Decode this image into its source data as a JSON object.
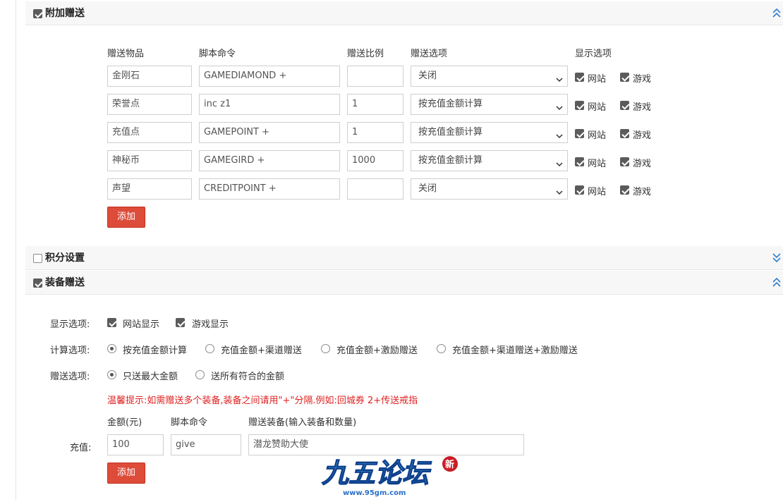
{
  "section1": {
    "title": "附加赠送",
    "columns": [
      "赠送物品",
      "脚本命令",
      "赠送比例",
      "赠送选项",
      "显示选项"
    ],
    "rows": [
      {
        "item": "金刚石",
        "command": "GAMEDIAMOND +",
        "ratio": "",
        "option": "关闭",
        "web": "网站",
        "game": "游戏"
      },
      {
        "item": "荣誉点",
        "command": "inc  z1",
        "ratio": "1",
        "option": "按充值金额计算",
        "web": "网站",
        "game": "游戏"
      },
      {
        "item": "充值点",
        "command": "GAMEPOINT +",
        "ratio": "1",
        "option": "按充值金额计算",
        "web": "网站",
        "game": "游戏"
      },
      {
        "item": "神秘币",
        "command": "GAMEGIRD +",
        "ratio": "1000",
        "option": "按充值金额计算",
        "web": "网站",
        "game": "游戏"
      },
      {
        "item": "声望",
        "command": "CREDITPOINT +",
        "ratio": "",
        "option": "关闭",
        "web": "网站",
        "game": "游戏"
      }
    ],
    "add_label": "添加"
  },
  "section2": {
    "title": "积分设置"
  },
  "section3": {
    "title": "装备赠送",
    "display_label": "显示选项:",
    "display_web": "网站显示",
    "display_game": "游戏显示",
    "calc_label": "计算选项:",
    "calc_options": [
      "按充值金额计算",
      "充值金额+渠道赠送",
      "充值金额+激励赠送",
      "充值金额+渠道赠送+激励赠送"
    ],
    "gift_label": "赠送选项:",
    "gift_options": [
      "只送最大金额",
      "送所有符合的金额"
    ],
    "hint": "温馨提示:如需赠送多个装备,装备之间请用\"+\"分隔.例如:回城券 2+传送戒指",
    "col_amount": "金额(元)",
    "col_command": "脚本命令",
    "col_equip": "赠送装备(输入装备和数量)",
    "recharge_label": "充值:",
    "amount": "100",
    "command": "give",
    "equip": "潜龙赞助大使",
    "add_label": "添加"
  },
  "watermark": {
    "text": "九五论坛",
    "sub": "www.95gm.com",
    "badge": "新"
  },
  "colors": {
    "accent_red": "#dd4b39",
    "hint_red": "#e02020",
    "chevron_blue": "#2f7fd0"
  }
}
